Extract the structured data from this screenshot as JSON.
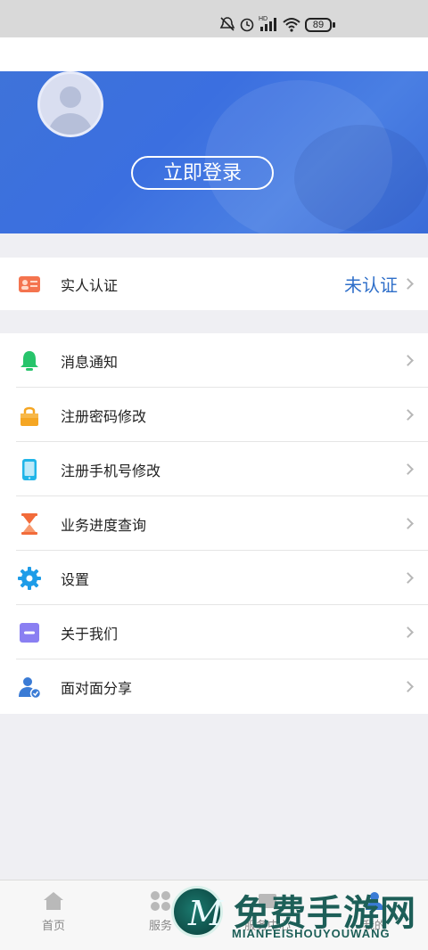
{
  "status_bar": {
    "icons": [
      "mute-alarm-icon",
      "alarm-icon",
      "hd-signal-icon",
      "wifi-icon"
    ],
    "battery": "89"
  },
  "banner": {
    "login_button": "立即登录"
  },
  "verify": {
    "label": "实人认证",
    "value": "未认证",
    "icon": "id-card-icon",
    "icon_color": "#f4744f",
    "value_color": "#2f6fc9"
  },
  "menu": {
    "items": [
      {
        "label": "消息通知",
        "icon": "bell-icon",
        "color": "#27c46b"
      },
      {
        "label": "注册密码修改",
        "icon": "lock-icon",
        "color": "#f5a623"
      },
      {
        "label": "注册手机号修改",
        "icon": "phone-icon",
        "color": "#21b5e8"
      },
      {
        "label": "业务进度查询",
        "icon": "hourglass-icon",
        "color": "#f26b3a"
      },
      {
        "label": "设置",
        "icon": "gear-icon",
        "color": "#1e9ce8"
      },
      {
        "label": "关于我们",
        "icon": "info-box-icon",
        "color": "#8a7ff2"
      },
      {
        "label": "面对面分享",
        "icon": "user-share-icon",
        "color": "#3a7bd5"
      }
    ]
  },
  "tabbar": {
    "tabs": [
      {
        "label": "首页",
        "icon": "home-icon"
      },
      {
        "label": "服务",
        "icon": "grid-icon"
      },
      {
        "label": "服务中心",
        "icon": "service-icon"
      },
      {
        "label": "我的",
        "icon": "user-icon"
      }
    ]
  },
  "watermark": {
    "title": "免费手游网",
    "subtitle": "MIANFEISHOUYOUWANG",
    "logo_letter": "M"
  }
}
